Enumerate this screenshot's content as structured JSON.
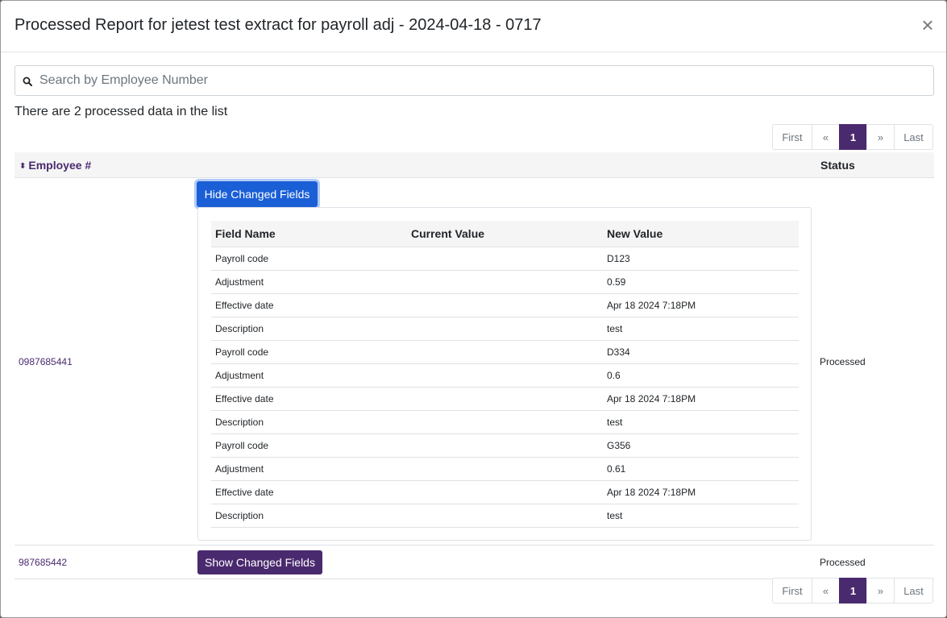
{
  "modal": {
    "title": "Processed Report for jetest test extract for payroll adj - 2024-04-18 - 0717",
    "close_glyph": "×"
  },
  "search": {
    "placeholder": "Search by Employee Number",
    "value": ""
  },
  "summary_text": "There are 2 processed data in the list",
  "pagination": {
    "first": "First",
    "prev": "«",
    "current": "1",
    "next": "»",
    "last": "Last"
  },
  "table": {
    "sort_glyph": "⬍",
    "headers": {
      "employee": "Employee #",
      "status": "Status"
    },
    "rows": [
      {
        "employee": "0987685441",
        "status": "Processed",
        "toggle_label": "Hide Changed Fields",
        "expanded": true,
        "fields_headers": [
          "Field Name",
          "Current Value",
          "New Value"
        ],
        "fields": [
          [
            "Payroll code",
            "",
            "D123"
          ],
          [
            "Adjustment",
            "",
            "0.59"
          ],
          [
            "Effective date",
            "",
            "Apr 18 2024 7:18PM"
          ],
          [
            "Description",
            "",
            "test"
          ],
          [
            "Payroll code",
            "",
            "D334"
          ],
          [
            "Adjustment",
            "",
            "0.6"
          ],
          [
            "Effective date",
            "",
            "Apr 18 2024 7:18PM"
          ],
          [
            "Description",
            "",
            "test"
          ],
          [
            "Payroll code",
            "",
            "G356"
          ],
          [
            "Adjustment",
            "",
            "0.61"
          ],
          [
            "Effective date",
            "",
            "Apr 18 2024 7:18PM"
          ],
          [
            "Description",
            "",
            "test"
          ]
        ]
      },
      {
        "employee": "987685442",
        "status": "Processed",
        "toggle_label": "Show Changed Fields",
        "expanded": false
      }
    ]
  },
  "colors": {
    "accent": "#4a2a6e",
    "primary_blue": "#1a5fd6"
  }
}
